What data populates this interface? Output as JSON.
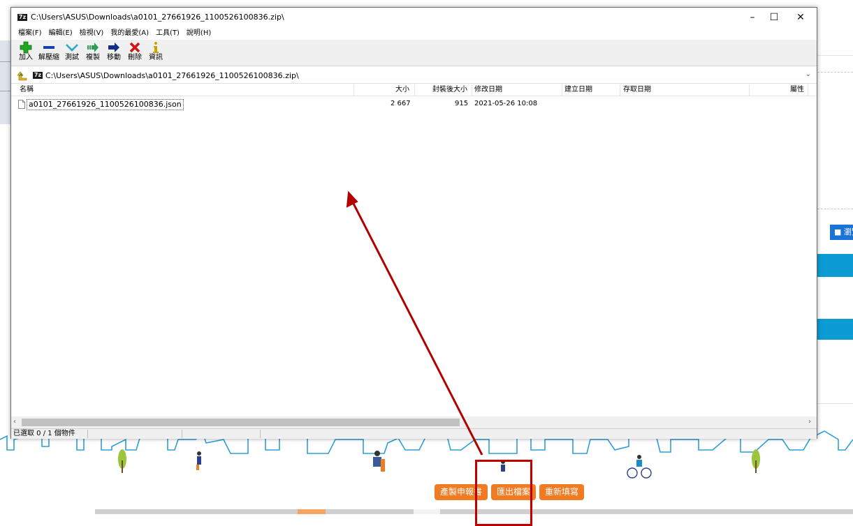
{
  "window": {
    "title": "C:\\Users\\ASUS\\Downloads\\a0101_27661926_1100526100836.zip\\",
    "logo": "7z",
    "minimize_glyph": "–",
    "maximize_glyph": "☐",
    "close_glyph": "✕"
  },
  "menu": [
    "檔案(F)",
    "編輯(E)",
    "檢視(V)",
    "我的最愛(A)",
    "工具(T)",
    "說明(H)"
  ],
  "toolbar": [
    {
      "label": "加入",
      "icon": "plus-icon",
      "color": "#1fa81f"
    },
    {
      "label": "解壓縮",
      "icon": "minus-icon",
      "color": "#1c3fb0"
    },
    {
      "label": "測試",
      "icon": "check-icon",
      "color": "#2aa7c9"
    },
    {
      "label": "複製",
      "icon": "copy-arrow-icon",
      "color": "#2a9e57"
    },
    {
      "label": "移動",
      "icon": "move-arrow-icon",
      "color": "#152b8c"
    },
    {
      "label": "刪除",
      "icon": "delete-x-icon",
      "color": "#d01414"
    },
    {
      "label": "資訊",
      "icon": "info-icon",
      "color": "#c9a300"
    }
  ],
  "address": {
    "path": "C:\\Users\\ASUS\\Downloads\\a0101_27661926_1100526100836.zip\\",
    "logo": "7z"
  },
  "columns": {
    "name": "名稱",
    "size": "大小",
    "packed": "封裝後大小",
    "modified": "修改日期",
    "created": "建立日期",
    "accessed": "存取日期",
    "attributes": "屬性"
  },
  "files": [
    {
      "name": "a0101_27661926_1100526100836.json",
      "size": "2 667",
      "packed": "915",
      "modified": "2021-05-26 10:08"
    }
  ],
  "status": {
    "selection": "已選取 0 / 1 個物件"
  },
  "background_page": {
    "buttons": [
      "產製申報書",
      "匯出檔案",
      "重新填寫"
    ],
    "browse_label": "瀏覽",
    "accent_orange": "#f07b22",
    "accent_blue": "#0d9bd3"
  },
  "annotation": {
    "arrow_color": "#b00000"
  }
}
